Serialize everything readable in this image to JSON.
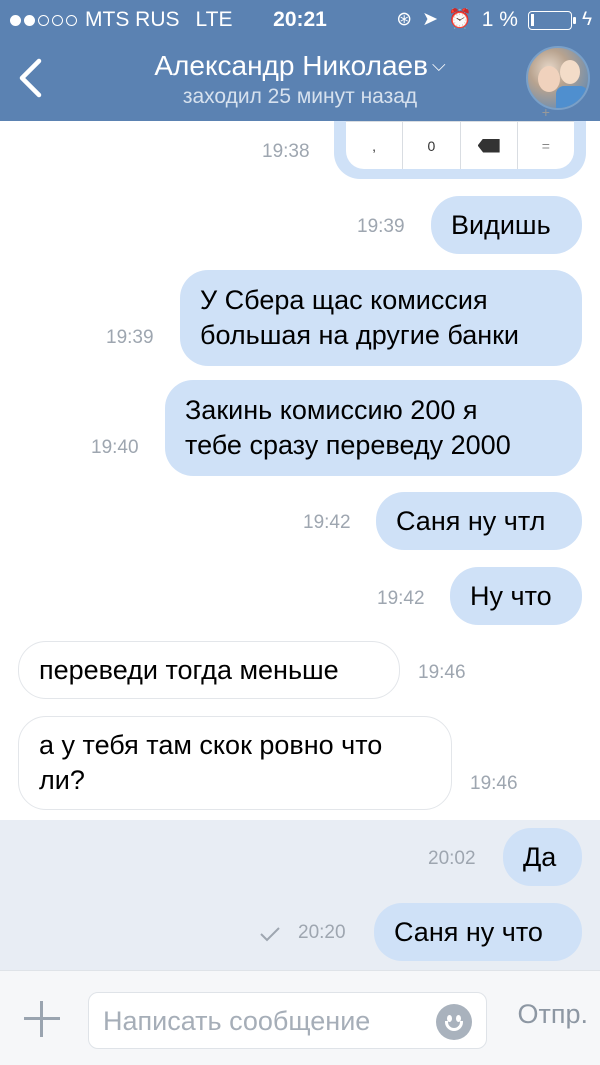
{
  "status_bar": {
    "carrier": "MTS RUS",
    "network": "LTE",
    "time": "20:21",
    "battery_text": "1 %",
    "battery_level": 0.01
  },
  "header": {
    "contact_name": "Александр Николаев",
    "contact_status": "заходил 25 минут назад"
  },
  "keypad": {
    "keys": [
      ",",
      "0",
      "=",
      "="
    ],
    "key_comma": ",",
    "key_zero": "0",
    "key_eq": "="
  },
  "messages": [
    {
      "dir": "out",
      "text": "",
      "time": "19:38"
    },
    {
      "dir": "out",
      "text": "Видишь",
      "time": "19:39"
    },
    {
      "dir": "out",
      "text_line1": "У Сбера щас комиссия",
      "text_line2": "большая на другие банки",
      "time": "19:39"
    },
    {
      "dir": "out",
      "text_line1": "Закинь комиссию 200 я",
      "text_line2": "тебе сразу переведу 2000",
      "time": "19:40"
    },
    {
      "dir": "out",
      "text": "Саня ну чтл",
      "time": "19:42"
    },
    {
      "dir": "out",
      "text": "Ну что",
      "time": "19:42"
    },
    {
      "dir": "in",
      "text": "переведи тогда меньше",
      "time": "19:46"
    },
    {
      "dir": "in",
      "text_line1": "а у тебя там скок ровно что",
      "text_line2": "ли?",
      "time": "19:46"
    },
    {
      "dir": "out",
      "text": "Да",
      "time": "20:02"
    },
    {
      "dir": "out",
      "text": "Саня ну что",
      "time": "20:20"
    }
  ],
  "input": {
    "placeholder": "Написать сообщение",
    "send_label": "Отпр."
  },
  "colors": {
    "header_bg": "#5b82b2",
    "outgoing_bubble": "#cfe1f7",
    "incoming_bubble": "#ffffff"
  },
  "icons": {
    "back": "chevron-left-icon",
    "dropdown": "chevron-down-icon",
    "attach": "plus-icon",
    "emoji": "smile-icon",
    "sent": "checkmark-icon"
  }
}
